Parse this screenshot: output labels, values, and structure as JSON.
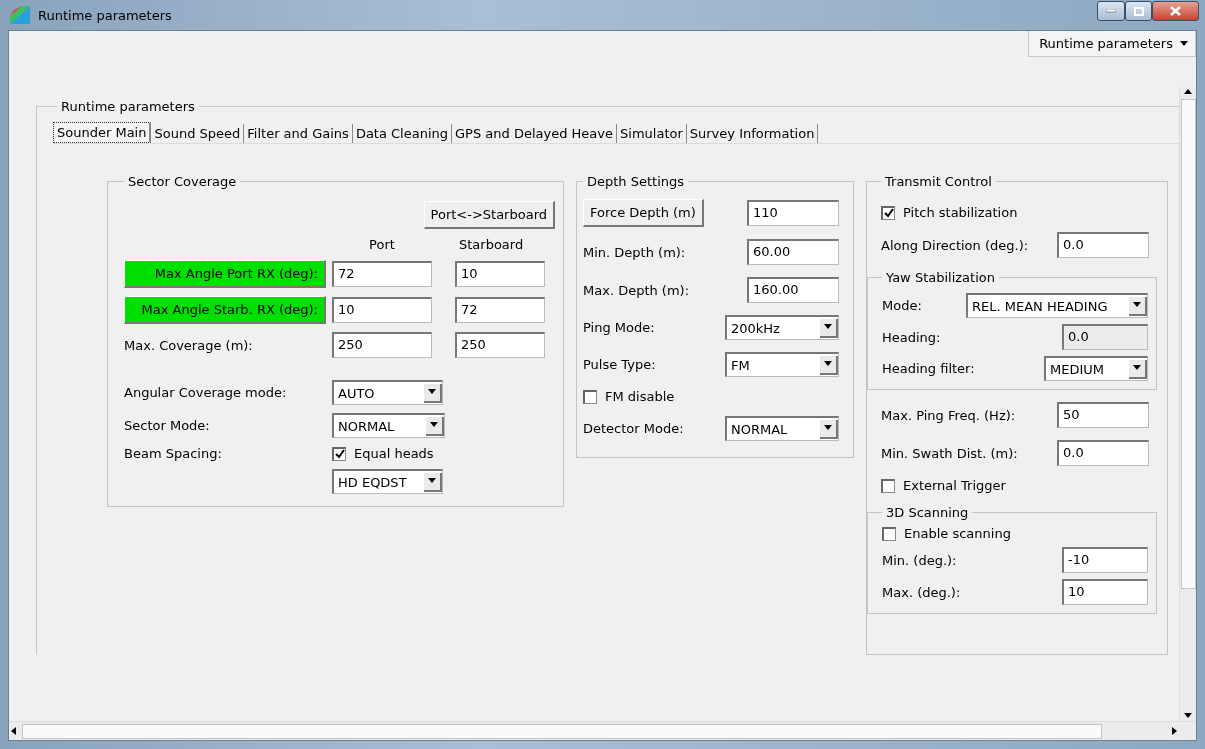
{
  "window": {
    "title": "Runtime parameters"
  },
  "menu_button": {
    "label": "Runtime parameters"
  },
  "group_title": "Runtime parameters",
  "tabs": [
    {
      "label": "Sounder Main",
      "selected": true
    },
    {
      "label": "Sound Speed",
      "selected": false
    },
    {
      "label": "Filter and Gains",
      "selected": false
    },
    {
      "label": "Data Cleaning",
      "selected": false
    },
    {
      "label": "GPS and Delayed Heave",
      "selected": false
    },
    {
      "label": "Simulator",
      "selected": false
    },
    {
      "label": "Survey Information",
      "selected": false
    }
  ],
  "sector_coverage": {
    "title": "Sector Coverage",
    "swap_button": "Port<->Starboard",
    "columns": [
      "Port",
      "Starboard"
    ],
    "rows": [
      {
        "label": "Max Angle Port RX (deg):",
        "highlighted": true,
        "port": "72",
        "starboard": "10"
      },
      {
        "label": "Max Angle Starb. RX (deg):",
        "highlighted": true,
        "port": "10",
        "starboard": "72"
      },
      {
        "label": "Max. Coverage (m):",
        "highlighted": false,
        "port": "250",
        "starboard": "250"
      }
    ],
    "angular_coverage_mode": {
      "label": "Angular Coverage mode:",
      "value": "AUTO"
    },
    "sector_mode": {
      "label": "Sector Mode:",
      "value": "NORMAL"
    },
    "beam_spacing": {
      "label": "Beam Spacing:",
      "checkbox": {
        "label": "Equal heads",
        "checked": true
      },
      "value": "HD EQDST"
    }
  },
  "depth_settings": {
    "title": "Depth Settings",
    "items": [
      {
        "kind": "button_field",
        "label": "Force Depth (m)",
        "value": "110"
      },
      {
        "kind": "field",
        "label": "Min. Depth (m):",
        "value": "60.00"
      },
      {
        "kind": "field",
        "label": "Max. Depth (m):",
        "value": "160.00"
      },
      {
        "kind": "select",
        "label": "Ping Mode:",
        "value": "200kHz"
      },
      {
        "kind": "select",
        "label": "Pulse Type:",
        "value": "FM"
      },
      {
        "kind": "checkbox",
        "label": "FM disable",
        "checked": false
      },
      {
        "kind": "select",
        "label": "Detector Mode:",
        "value": "NORMAL"
      }
    ]
  },
  "transmit_control": {
    "title": "Transmit Control",
    "items": [
      {
        "kind": "checkbox",
        "label": "Pitch stabilization",
        "checked": true
      },
      {
        "kind": "field",
        "label": "Along Direction (deg.):",
        "value": "0.0"
      },
      {
        "kind": "group",
        "title": "Yaw Stabilization",
        "items": [
          {
            "kind": "select",
            "label": "Mode:",
            "value": "REL. MEAN HEADING"
          },
          {
            "kind": "field",
            "label": "Heading:",
            "value": "0.0",
            "disabled": true
          },
          {
            "kind": "select",
            "label": "Heading filter:",
            "value": "MEDIUM"
          }
        ]
      },
      {
        "kind": "field",
        "label": "Max. Ping Freq. (Hz):",
        "value": "50"
      },
      {
        "kind": "field",
        "label": "Min. Swath Dist. (m):",
        "value": "0.0"
      },
      {
        "kind": "checkbox",
        "label": "External Trigger",
        "checked": false
      },
      {
        "kind": "group",
        "title": "3D Scanning",
        "items": [
          {
            "kind": "checkbox",
            "label": "Enable scanning",
            "checked": false
          },
          {
            "kind": "field",
            "label": "Min. (deg.):",
            "value": "-10",
            "disabled": false
          },
          {
            "kind": "field",
            "label": "Max. (deg.):",
            "value": "10",
            "disabled": false
          }
        ]
      }
    ]
  }
}
